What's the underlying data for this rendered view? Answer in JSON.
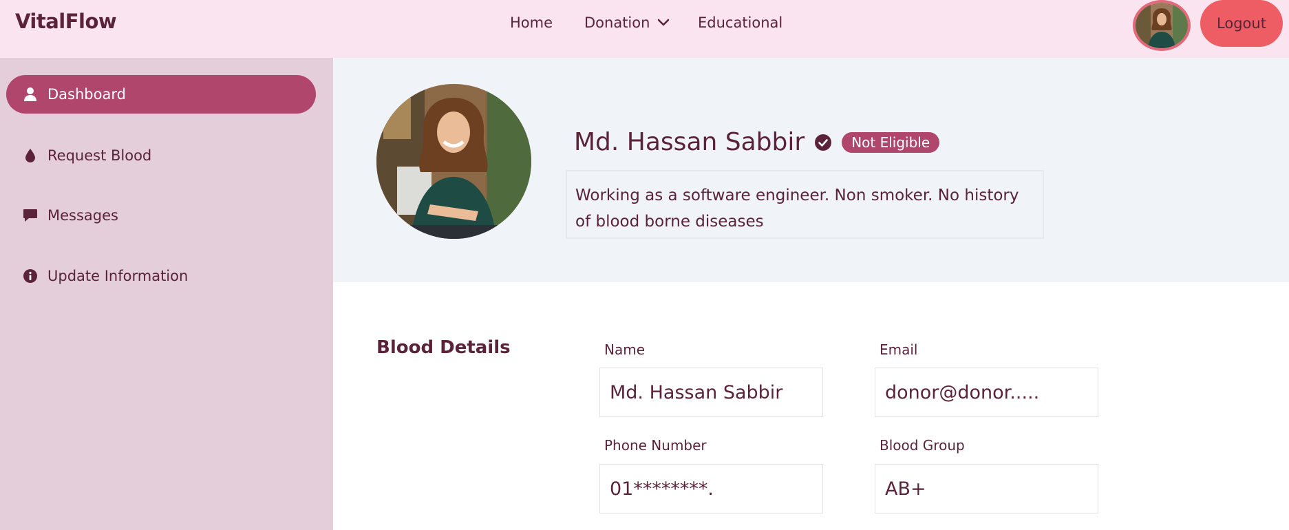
{
  "brand": "VitalFlow",
  "nav": {
    "home": "Home",
    "donation": "Donation",
    "educational": "Educational",
    "logout": "Logout"
  },
  "sidebar": {
    "items": [
      {
        "label": "Dashboard",
        "icon": "user-icon",
        "active": true
      },
      {
        "label": "Request Blood",
        "icon": "blood-drop-icon"
      },
      {
        "label": "Messages",
        "icon": "message-icon"
      },
      {
        "label": "Update Information",
        "icon": "info-icon"
      }
    ]
  },
  "profile": {
    "name": "Md. Hassan Sabbir",
    "status": "Not Eligible",
    "bio": "Working as a software engineer. Non smoker. No history of blood borne diseases"
  },
  "blood_details": {
    "title": "Blood Details",
    "fields": {
      "name": {
        "label": "Name",
        "value": "Md. Hassan Sabbir"
      },
      "email": {
        "label": "Email",
        "value": "donor@donor....."
      },
      "phone": {
        "label": "Phone Number",
        "value": "01********."
      },
      "blood_group": {
        "label": "Blood Group",
        "value": "AB+"
      }
    }
  },
  "colors": {
    "accent": "#b0466b",
    "logout": "#ee5d64",
    "topbar": "#f9e4f0",
    "sidebar": "#e4ceda",
    "text": "#5a2339"
  }
}
